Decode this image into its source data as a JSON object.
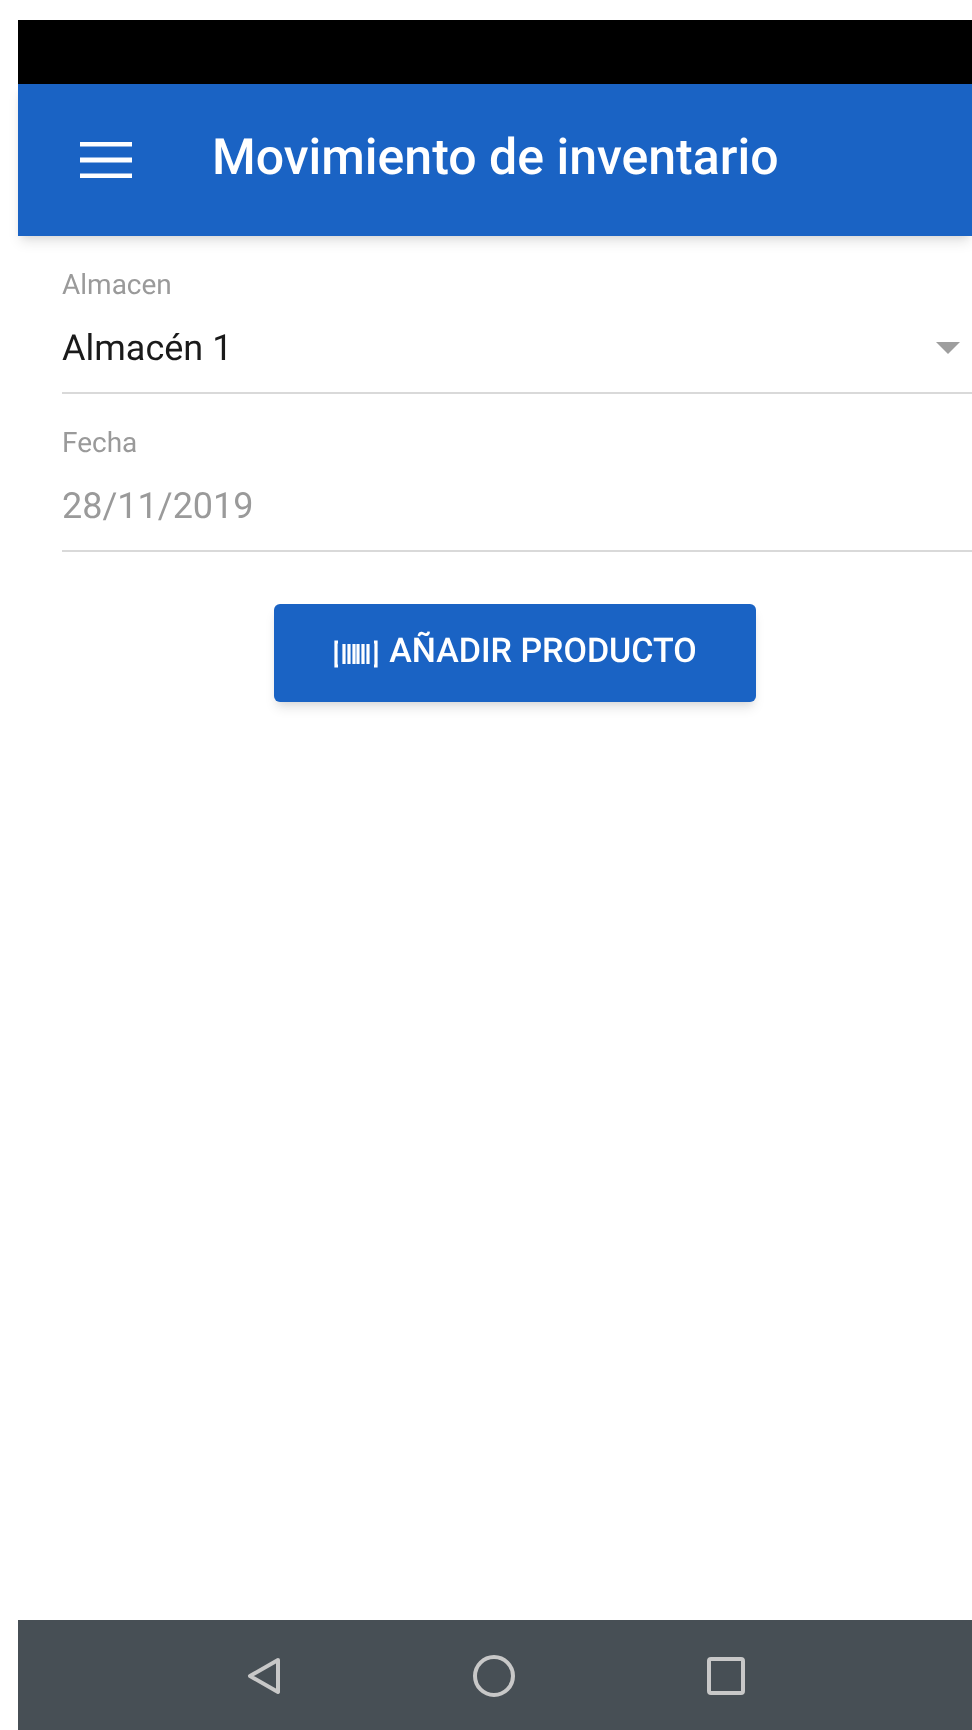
{
  "app_bar": {
    "title": "Movimiento de inventario"
  },
  "fields": [
    {
      "kind": "select",
      "label": "Almacen",
      "value": "Almacén 1",
      "disabled": false
    },
    {
      "kind": "text",
      "label": "Fecha",
      "value": "28/11/2019",
      "disabled": true
    }
  ],
  "action_button": {
    "label": "AÑADIR PRODUCTO"
  }
}
